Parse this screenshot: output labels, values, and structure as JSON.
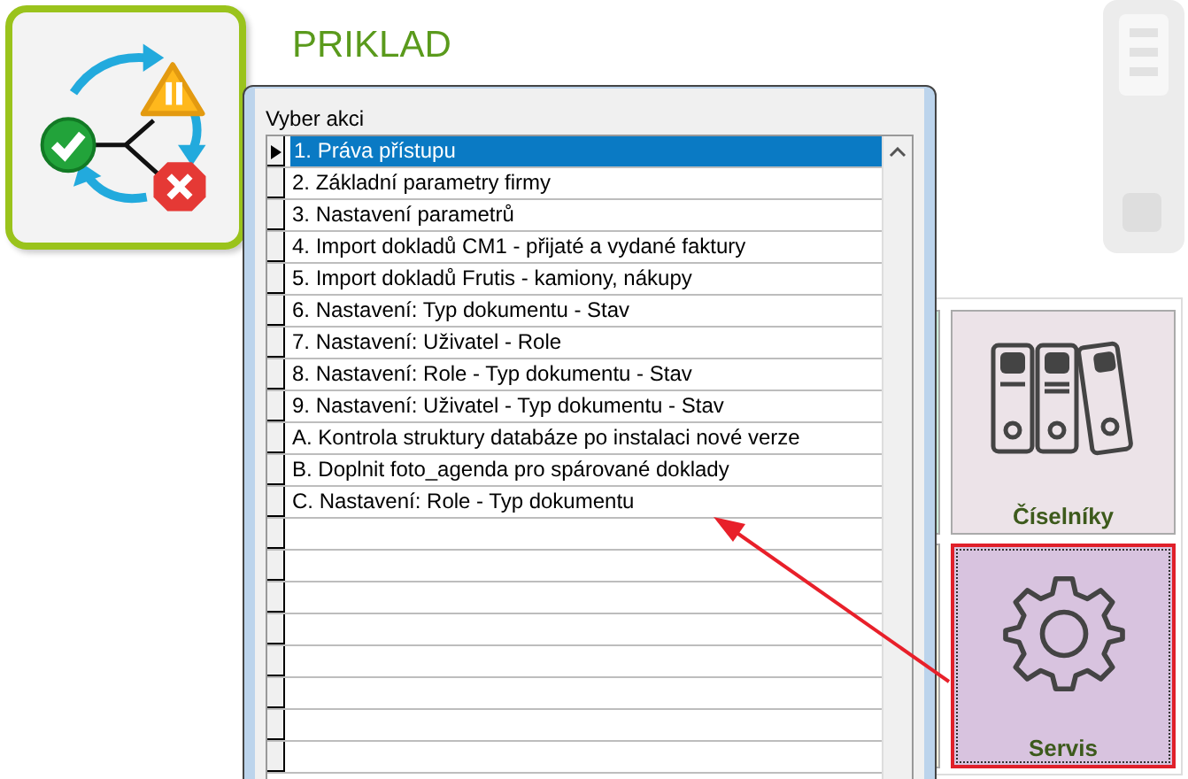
{
  "header": {
    "title": "PRIKLAD"
  },
  "dialog": {
    "label": "Vyber akci",
    "rows": [
      {
        "text": "1. Práva přístupu",
        "selected": true
      },
      {
        "text": "2. Základní parametry firmy",
        "selected": false
      },
      {
        "text": "3. Nastavení parametrů",
        "selected": false
      },
      {
        "text": "4. Import dokladů CM1 - přijaté a vydané faktury",
        "selected": false
      },
      {
        "text": "5. Import dokladů Frutis - kamiony, nákupy",
        "selected": false
      },
      {
        "text": "6. Nastavení: Typ dokumentu - Stav",
        "selected": false
      },
      {
        "text": "7. Nastavení: Uživatel - Role",
        "selected": false
      },
      {
        "text": "8. Nastavení: Role - Typ dokumentu - Stav",
        "selected": false
      },
      {
        "text": "9. Nastavení: Uživatel - Typ dokumentu - Stav",
        "selected": false
      },
      {
        "text": "A. Kontrola struktury databáze po instalaci nové verze",
        "selected": false
      },
      {
        "text": "B. Doplnit foto_agenda pro spárované doklady",
        "selected": false
      },
      {
        "text": "C. Nastavení: Role - Typ dokumentu",
        "selected": false
      }
    ]
  },
  "tiles": [
    {
      "label": "Číselníky",
      "kind": "binders",
      "selected": false
    },
    {
      "label": "Servis",
      "kind": "gear",
      "selected": true
    }
  ]
}
